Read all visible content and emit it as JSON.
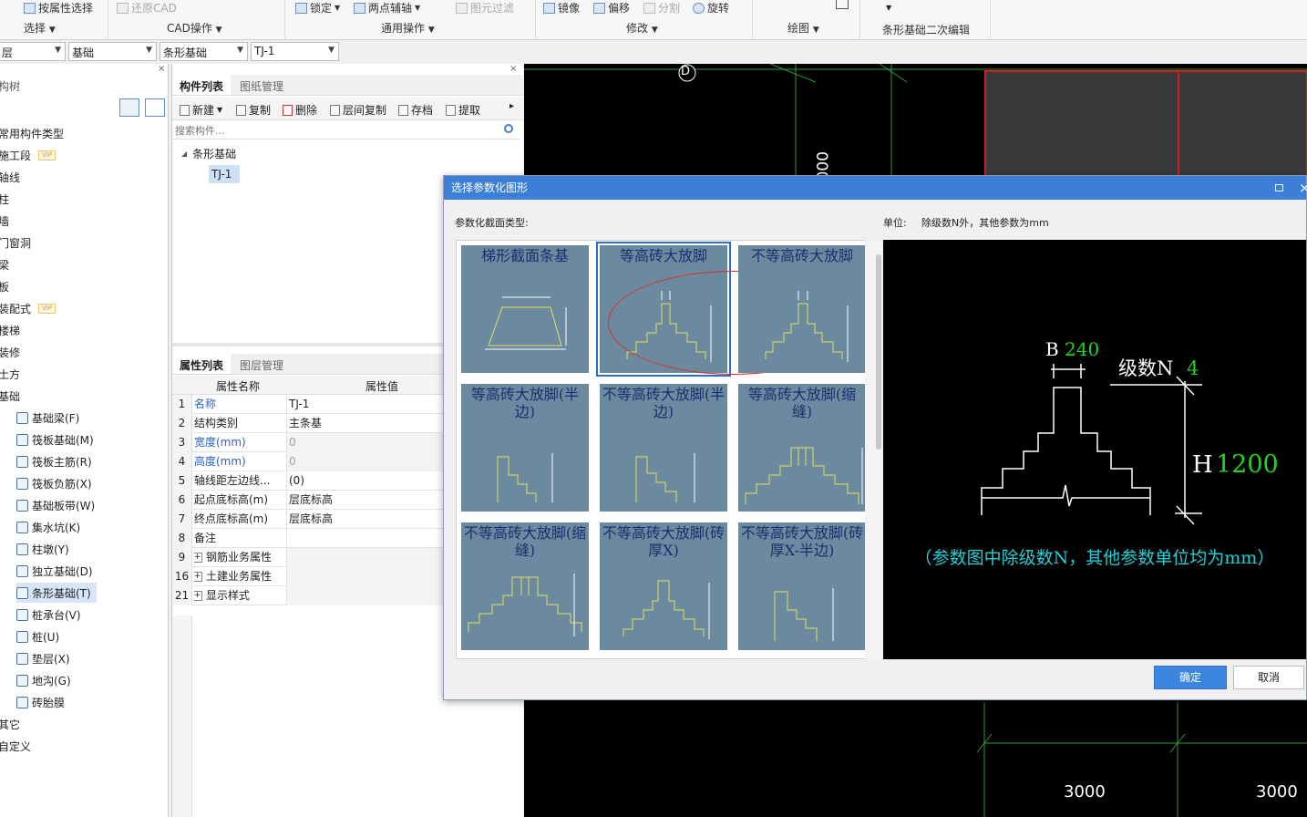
{
  "ribbon": {
    "items": {
      "select_by_attr": "按属性选择",
      "restore_cad": "还原CAD",
      "lock": "锁定",
      "two_point_aux": "两点辅轴",
      "filter_elements": "图元过滤",
      "mirror": "镜像",
      "offset": "偏移",
      "split": "分割",
      "rotate": "旋转"
    },
    "groups": {
      "select": "选择",
      "cad_ops": "CAD操作",
      "common_ops": "通用操作",
      "modify": "修改",
      "draw": "绘图",
      "strip_edit": "条形基础二次编辑"
    }
  },
  "filters": {
    "floor": "层",
    "category": "基础",
    "type": "条形基础",
    "component": "TJ-1"
  },
  "left_tree": {
    "title": "构树",
    "items": [
      {
        "label": "常用构件类型"
      },
      {
        "label": "施工段",
        "vip": "VIP"
      },
      {
        "label": "轴线"
      },
      {
        "label": "柱"
      },
      {
        "label": "墙"
      },
      {
        "label": "门窗洞"
      },
      {
        "label": "梁"
      },
      {
        "label": "板"
      },
      {
        "label": "装配式",
        "vip": "VIP"
      },
      {
        "label": "楼梯"
      },
      {
        "label": "装修"
      },
      {
        "label": "土方"
      },
      {
        "label": "基础"
      }
    ],
    "sub_items": [
      {
        "label": "基础梁(F)"
      },
      {
        "label": "筏板基础(M)"
      },
      {
        "label": "筏板主筋(R)"
      },
      {
        "label": "筏板负筋(X)"
      },
      {
        "label": "基础板带(W)"
      },
      {
        "label": "集水坑(K)"
      },
      {
        "label": "柱墩(Y)"
      },
      {
        "label": "独立基础(D)"
      },
      {
        "label": "条形基础(T)"
      },
      {
        "label": "桩承台(V)"
      },
      {
        "label": "桩(U)"
      },
      {
        "label": "垫层(X)"
      },
      {
        "label": "地沟(G)"
      },
      {
        "label": "砖胎膜"
      }
    ],
    "tail_items": [
      {
        "label": "其它"
      },
      {
        "label": "自定义"
      }
    ]
  },
  "component_panel": {
    "tabs": [
      "构件列表",
      "图纸管理"
    ],
    "toolbar": [
      "新建",
      "复制",
      "删除",
      "层间复制",
      "存档",
      "提取"
    ],
    "search_placeholder": "搜索构件...",
    "tree_root": "条形基础",
    "tree_child": "TJ-1"
  },
  "property_panel": {
    "tabs": [
      "属性列表",
      "图层管理"
    ],
    "header": {
      "name": "属性名称",
      "value": "属性值"
    },
    "rows": [
      {
        "num": "1",
        "name": "名称",
        "value": "TJ-1"
      },
      {
        "num": "2",
        "name": "结构类别",
        "value": "主条基"
      },
      {
        "num": "3",
        "name": "宽度(mm)",
        "value": "0"
      },
      {
        "num": "4",
        "name": "高度(mm)",
        "value": "0"
      },
      {
        "num": "5",
        "name": "轴线距左边线...",
        "value": "(0)"
      },
      {
        "num": "6",
        "name": "起点底标高(m)",
        "value": "层底标高"
      },
      {
        "num": "7",
        "name": "终点底标高(m)",
        "value": "层底标高"
      },
      {
        "num": "8",
        "name": "备注",
        "value": ""
      },
      {
        "num": "9",
        "name": "钢筋业务属性",
        "value": ""
      },
      {
        "num": "16",
        "name": "土建业务属性",
        "value": ""
      },
      {
        "num": "21",
        "name": "显示样式",
        "value": ""
      }
    ]
  },
  "cad_canvas": {
    "axis_label": "D",
    "dim_vertical": "000",
    "dim_bottom_1": "3000",
    "dim_bottom_2": "3000"
  },
  "dialog": {
    "title": "选择参数化图形",
    "section_label": "参数化截面类型:",
    "unit_label": "单位:",
    "unit_text": "除级数N外，其他参数为mm",
    "thumbs": [
      {
        "caption": "梯形截面条基"
      },
      {
        "caption": "等高砖大放脚"
      },
      {
        "caption": "不等高砖大放脚"
      },
      {
        "caption": "等高砖大放脚(半边)"
      },
      {
        "caption": "不等高砖大放脚(半边)"
      },
      {
        "caption": "等高砖大放脚(缩缝)"
      },
      {
        "caption": "不等高砖大放脚(缩缝)"
      },
      {
        "caption": "不等高砖大放脚(砖厚X)"
      },
      {
        "caption": "不等高砖大放脚(砖厚X-半边)"
      }
    ],
    "preview": {
      "b_label": "B",
      "b_value": "240",
      "n_label": "级数N",
      "n_value": "4",
      "h_label": "H",
      "h_value": "1200",
      "note": "（参数图中除级数N，其他参数单位均为mm）"
    },
    "ok": "确定",
    "cancel": "取消"
  }
}
